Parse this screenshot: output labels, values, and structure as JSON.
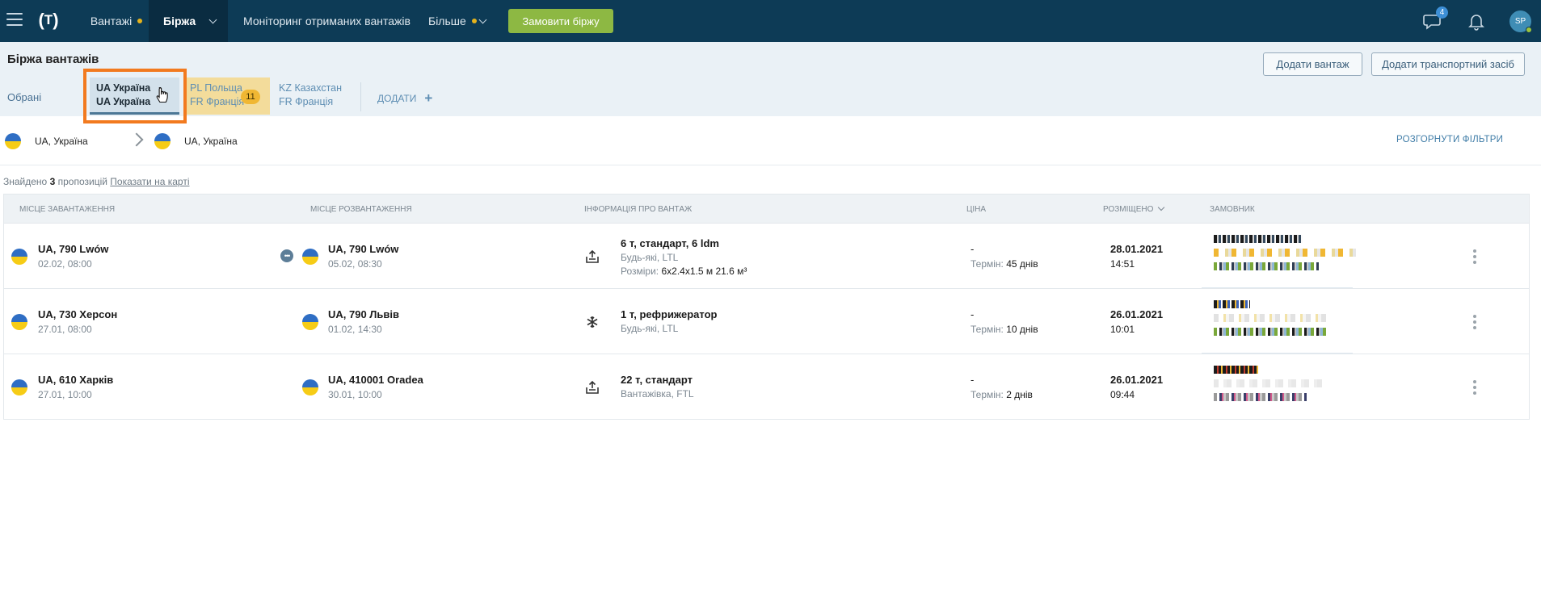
{
  "nav": {
    "menu_icon": "hamburger-icon",
    "logo_text": "T",
    "items": [
      {
        "label": "Вантажі"
      },
      {
        "label": "Біржа"
      },
      {
        "label": "Моніторинг отриманих вантажів"
      },
      {
        "label": "Більше"
      }
    ],
    "order_button": "Замовити біржу",
    "messages_badge": "4",
    "avatar_initials": "SP"
  },
  "header": {
    "title": "Біржа вантажів",
    "add_cargo": "Додати вантаж",
    "add_vehicle": "Додати транспортний засіб"
  },
  "tabs": {
    "favorites": "Обрані",
    "items": [
      {
        "line1": "UA Україна",
        "line2": "UA Україна"
      },
      {
        "line1": "PL Польща",
        "line2": "FR Франція",
        "count": "11"
      },
      {
        "line1": "KZ Казахстан",
        "line2": "FR Франція"
      }
    ],
    "add": "ДОДАТИ"
  },
  "route": {
    "from": "UA, Україна",
    "to": "UA, Україна",
    "expand_filters": "РОЗГОРНУТИ ФІЛЬТРИ"
  },
  "results": {
    "prefix": "Знайдено",
    "count": "3",
    "suffix": "пропозицій",
    "map_link": "Показати на карті"
  },
  "table": {
    "headers": {
      "loading": "МІСЦЕ ЗАВАНТАЖЕННЯ",
      "unloading": "МІСЦЕ РОЗВАНТАЖЕННЯ",
      "cargo": "ІНФОРМАЦІЯ ПРО ВАНТАЖ",
      "price": "ЦІНА",
      "posted": "РОЗМІЩЕНО",
      "customer": "ЗАМОВНИК"
    },
    "term_label": "Термін:",
    "rows": [
      {
        "load_city": "UA, 790 Lwów",
        "load_date": "02.02, 08:00",
        "unload_city": "UA, 790 Lwów",
        "unload_date": "05.02, 08:30",
        "cargo_icon": "upload-box-icon",
        "cargo_title": "6 т, стандарт, 6 ldm",
        "cargo_sub": "Будь-які, LTL",
        "dims_label": "Розміри:",
        "dims_value": "6x2.4x1.5 м 21.6 м³",
        "price": "-",
        "term_days": "45 днів",
        "posted_date": "28.01.2021",
        "posted_time": "14:51",
        "chat_marker": "•••"
      },
      {
        "load_city": "UA, 730 Херсон",
        "load_date": "27.01, 08:00",
        "unload_city": "UA, 790 Львів",
        "unload_date": "01.02, 14:30",
        "cargo_icon": "snowflake-icon",
        "cargo_title": "1 т, рефрижератор",
        "cargo_sub": "Будь-які, LTL",
        "price": "-",
        "term_days": "10 днів",
        "posted_date": "26.01.2021",
        "posted_time": "10:01"
      },
      {
        "load_city": "UA, 610 Харків",
        "load_date": "27.01, 10:00",
        "unload_city": "UA, 410001 Oradea",
        "unload_date": "30.01, 10:00",
        "cargo_icon": "upload-box-icon",
        "cargo_title": "22 т, стандарт",
        "cargo_sub": "Вантажівка, FTL",
        "price": "-",
        "term_days": "2 днів",
        "posted_date": "26.01.2021",
        "posted_time": "09:44"
      }
    ]
  },
  "colors": {
    "nav_bg": "#0d3b56",
    "accent_green": "#8db843",
    "highlight_orange": "#f27a1f",
    "badge_yellow": "#f0b733"
  }
}
